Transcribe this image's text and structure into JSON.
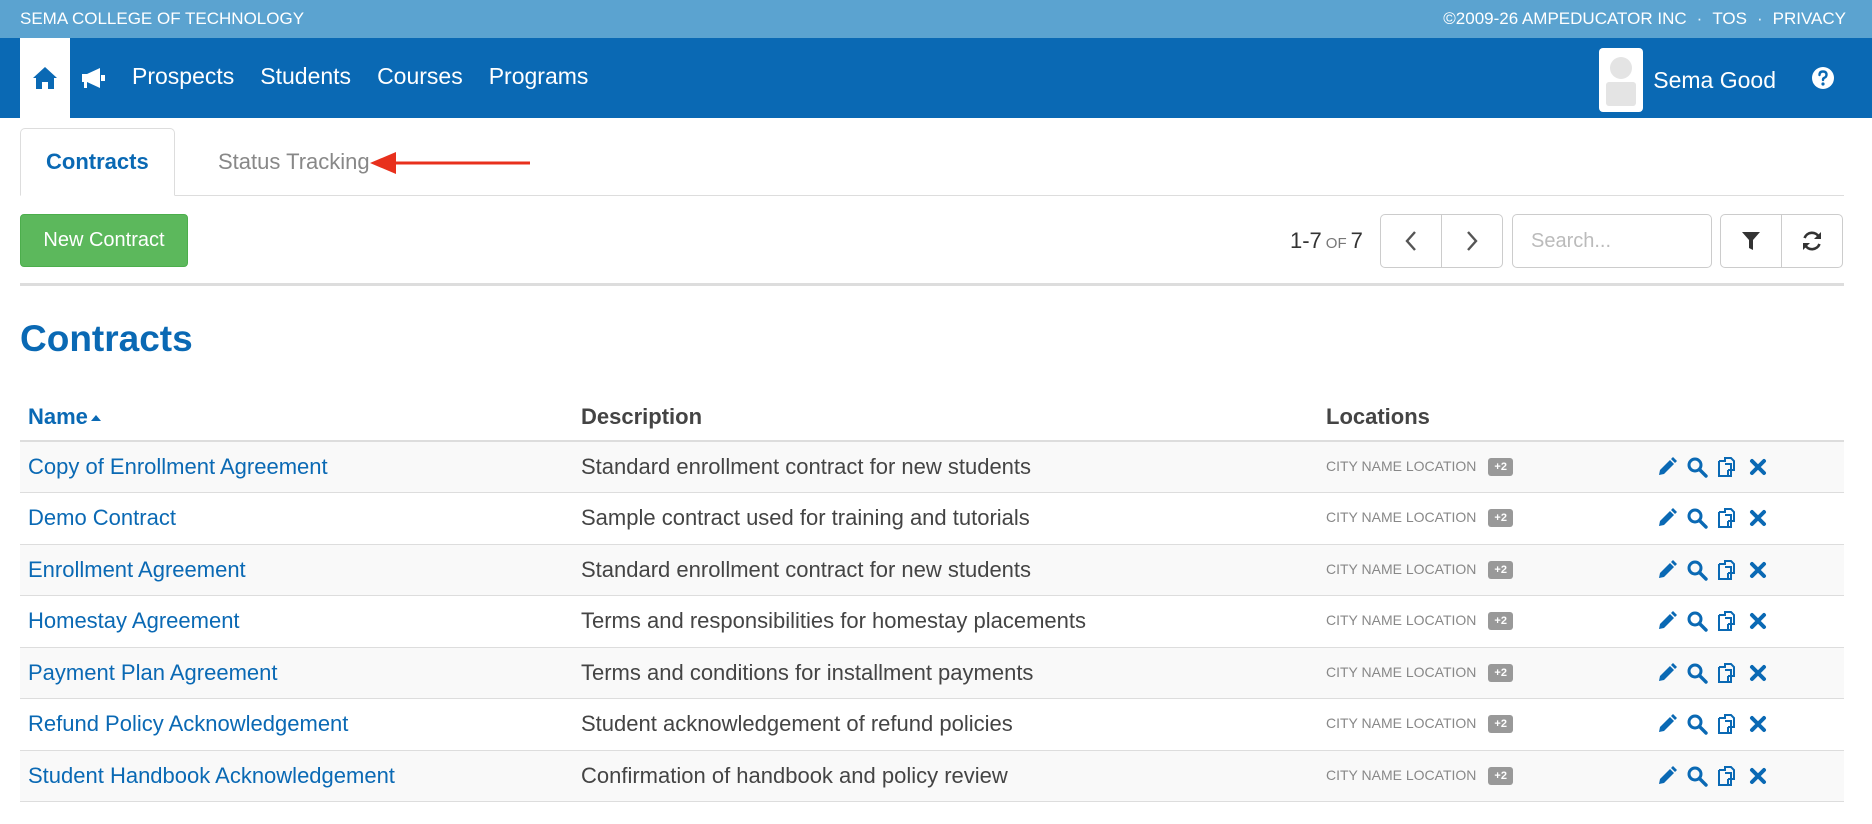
{
  "topbar": {
    "school_name": "SEMA COLLEGE OF TECHNOLOGY",
    "copyright": "©2009-26 AMPEDUCATOR INC",
    "separator": "·",
    "tos": "TOS",
    "privacy": "PRIVACY"
  },
  "nav": {
    "links": [
      "Prospects",
      "Students",
      "Courses",
      "Programs"
    ],
    "user_name": "Sema Good"
  },
  "tabs": {
    "active": "Contracts",
    "inactive": "Status Tracking"
  },
  "toolbar": {
    "new_button": "New Contract",
    "range": "1-7",
    "of": "OF",
    "total": "7",
    "search_placeholder": "Search..."
  },
  "page": {
    "title": "Contracts"
  },
  "table": {
    "headers": {
      "name": "Name",
      "description": "Description",
      "locations": "Locations"
    },
    "rows": [
      {
        "name": "Copy of Enrollment Agreement",
        "description": "Standard enrollment contract for new students",
        "location": "CITY NAME LOCATION",
        "badge": "+2"
      },
      {
        "name": "Demo Contract",
        "description": "Sample contract used for training and tutorials",
        "location": "CITY NAME LOCATION",
        "badge": "+2"
      },
      {
        "name": "Enrollment Agreement",
        "description": "Standard enrollment contract for new students",
        "location": "CITY NAME LOCATION",
        "badge": "+2"
      },
      {
        "name": "Homestay Agreement",
        "description": "Terms and responsibilities for homestay placements",
        "location": "CITY NAME LOCATION",
        "badge": "+2"
      },
      {
        "name": "Payment Plan Agreement",
        "description": "Terms and conditions for installment payments",
        "location": "CITY NAME LOCATION",
        "badge": "+2"
      },
      {
        "name": "Refund Policy Acknowledgement",
        "description": "Student acknowledgement of refund policies",
        "location": "CITY NAME LOCATION",
        "badge": "+2"
      },
      {
        "name": "Student Handbook Acknowledgement",
        "description": "Confirmation of handbook and policy review",
        "location": "CITY NAME LOCATION",
        "badge": "+2"
      }
    ]
  },
  "colors": {
    "topbar": "#5ba3d0",
    "navbar": "#0a69b4",
    "primary": "#0a69b4",
    "success": "#5cb85c",
    "annotation_arrow": "#e8301c"
  }
}
